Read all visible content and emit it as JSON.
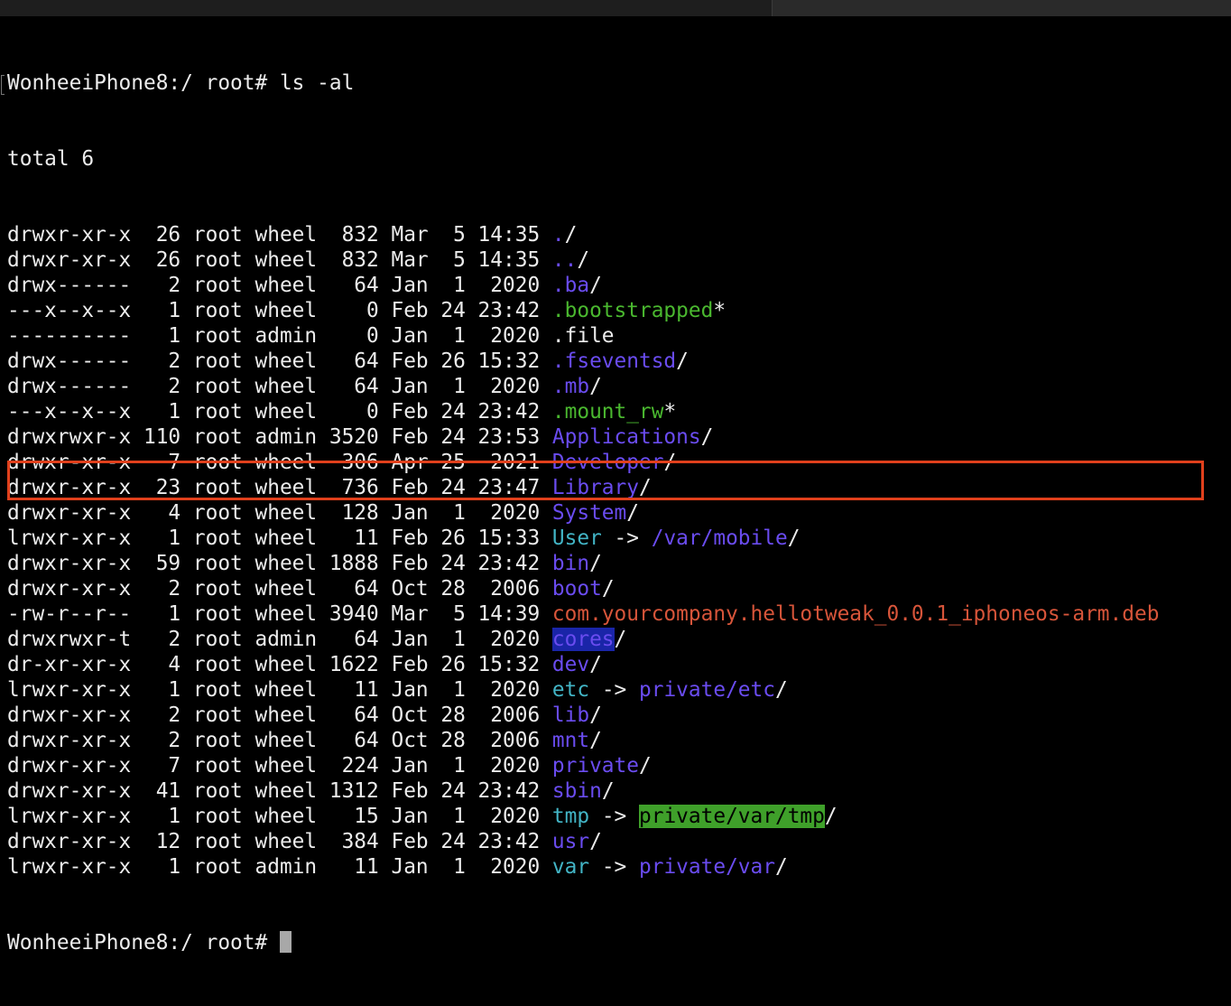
{
  "prompt_command": "WonheeiPhone8:/ root# ls -al",
  "total_line": "total 6",
  "entries": [
    {
      "meta": "drwxr-xr-x  26 root wheel  832 Mar  5 14:35 ",
      "name": ".",
      "name_color": "dir",
      "suffix": "/"
    },
    {
      "meta": "drwxr-xr-x  26 root wheel  832 Mar  5 14:35 ",
      "name": "..",
      "name_color": "dir",
      "suffix": "/"
    },
    {
      "meta": "drwx------   2 root wheel   64 Jan  1  2020 ",
      "name": ".ba",
      "name_color": "dir",
      "suffix": "/"
    },
    {
      "meta": "---x--x--x   1 root wheel    0 Feb 24 23:42 ",
      "name": ".bootstrapped",
      "name_color": "exec",
      "suffix": "*"
    },
    {
      "meta": "----------   1 root admin    0 Jan  1  2020 ",
      "name": ".file",
      "name_color": "file",
      "suffix": ""
    },
    {
      "meta": "drwx------   2 root wheel   64 Feb 26 15:32 ",
      "name": ".fseventsd",
      "name_color": "dir",
      "suffix": "/"
    },
    {
      "meta": "drwx------   2 root wheel   64 Jan  1  2020 ",
      "name": ".mb",
      "name_color": "dir",
      "suffix": "/"
    },
    {
      "meta": "---x--x--x   1 root wheel    0 Feb 24 23:42 ",
      "name": ".mount_rw",
      "name_color": "exec",
      "suffix": "*"
    },
    {
      "meta": "drwxrwxr-x 110 root admin 3520 Feb 24 23:53 ",
      "name": "Applications",
      "name_color": "dir",
      "suffix": "/"
    },
    {
      "meta": "drwxr-xr-x   7 root wheel  306 Apr 25  2021 ",
      "name": "Developer",
      "name_color": "dir",
      "suffix": "/"
    },
    {
      "meta": "drwxr-xr-x  23 root wheel  736 Feb 24 23:47 ",
      "name": "Library",
      "name_color": "dir",
      "suffix": "/"
    },
    {
      "meta": "drwxr-xr-x   4 root wheel  128 Jan  1  2020 ",
      "name": "System",
      "name_color": "dir",
      "suffix": "/"
    },
    {
      "meta": "lrwxr-xr-x   1 root wheel   11 Feb 26 15:33 ",
      "name": "User",
      "name_color": "link",
      "suffix": "",
      "arrow": " -> ",
      "target": "/var/mobile",
      "target_color": "dir",
      "target_suffix": "/"
    },
    {
      "meta": "drwxr-xr-x  59 root wheel 1888 Feb 24 23:42 ",
      "name": "bin",
      "name_color": "dir",
      "suffix": "/"
    },
    {
      "meta": "drwxr-xr-x   2 root wheel   64 Oct 28  2006 ",
      "name": "boot",
      "name_color": "dir",
      "suffix": "/"
    },
    {
      "meta": "-rw-r--r--   1 root wheel 3940 Mar  5 14:39 ",
      "name": "com.yourcompany.hellotweak_0.0.1_iphoneos-arm.deb",
      "name_color": "deb",
      "suffix": ""
    },
    {
      "meta": "drwxrwxr-t   2 root admin   64 Jan  1  2020 ",
      "name": "cores",
      "name_color": "dir-bg",
      "suffix": "/"
    },
    {
      "meta": "dr-xr-xr-x   4 root wheel 1622 Feb 26 15:32 ",
      "name": "dev",
      "name_color": "dir",
      "suffix": "/"
    },
    {
      "meta": "lrwxr-xr-x   1 root wheel   11 Jan  1  2020 ",
      "name": "etc",
      "name_color": "link",
      "suffix": "",
      "arrow": " -> ",
      "target": "private/etc",
      "target_color": "dir",
      "target_suffix": "/"
    },
    {
      "meta": "drwxr-xr-x   2 root wheel   64 Oct 28  2006 ",
      "name": "lib",
      "name_color": "dir",
      "suffix": "/"
    },
    {
      "meta": "drwxr-xr-x   2 root wheel   64 Oct 28  2006 ",
      "name": "mnt",
      "name_color": "dir",
      "suffix": "/"
    },
    {
      "meta": "drwxr-xr-x   7 root wheel  224 Jan  1  2020 ",
      "name": "private",
      "name_color": "dir",
      "suffix": "/"
    },
    {
      "meta": "drwxr-xr-x  41 root wheel 1312 Feb 24 23:42 ",
      "name": "sbin",
      "name_color": "dir",
      "suffix": "/"
    },
    {
      "meta": "lrwxr-xr-x   1 root wheel   15 Jan  1  2020 ",
      "name": "tmp",
      "name_color": "link",
      "suffix": "",
      "arrow": " -> ",
      "target": "private/var/tmp",
      "target_color": "green-bg",
      "target_suffix": "/"
    },
    {
      "meta": "drwxr-xr-x  12 root wheel  384 Feb 24 23:42 ",
      "name": "usr",
      "name_color": "dir",
      "suffix": "/"
    },
    {
      "meta": "lrwxr-xr-x   1 root admin   11 Jan  1  2020 ",
      "name": "var",
      "name_color": "link",
      "suffix": "",
      "arrow": " -> ",
      "target": "private/var",
      "target_color": "dir",
      "target_suffix": "/"
    }
  ],
  "final_prompt": "WonheeiPhone8:/ root# ",
  "colors": {
    "background": "#000000",
    "text": "#ececec",
    "directory": "#6a4cf0",
    "executable": "#4ab82f",
    "symlink": "#42b4c5",
    "deb_file": "#d7553a",
    "highlight_box": "#e0401c"
  }
}
